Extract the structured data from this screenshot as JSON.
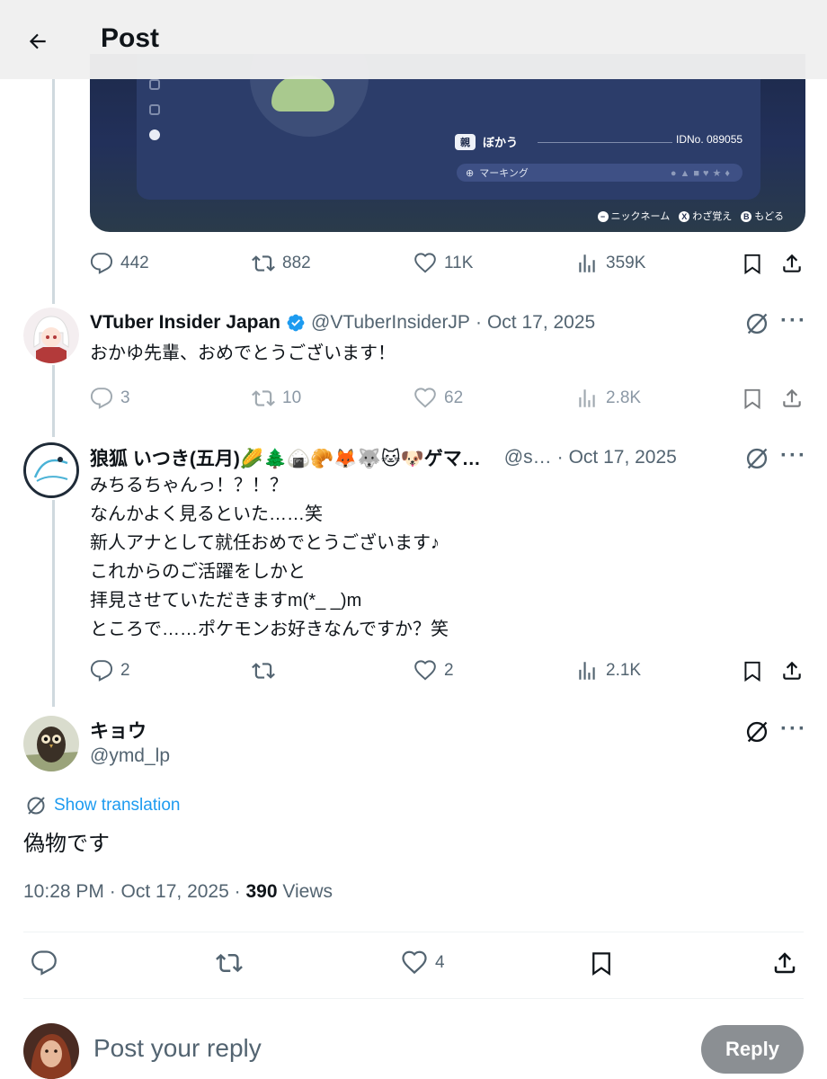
{
  "header": {
    "title": "Post"
  },
  "media": {
    "badge_label": "親",
    "trainer_name": "ぼかう",
    "id_no": "IDNo. 089055",
    "marking_label": "マーキング",
    "marking_shapes": "●▲■♥★♦",
    "footer": [
      {
        "key": "−",
        "label": "ニックネーム"
      },
      {
        "key": "X",
        "label": "わざ覚え"
      },
      {
        "key": "B",
        "label": "もどる"
      }
    ]
  },
  "quoted_post": {
    "stats": {
      "replies": "442",
      "reposts": "882",
      "likes": "11K",
      "views": "359K"
    }
  },
  "replies": [
    {
      "name": "VTuber Insider Japan",
      "handle": "@VTuberInsiderJP",
      "date": "Oct 17, 2025",
      "text": "おかゆ先輩、おめでとうございます！",
      "stats": {
        "replies": "3",
        "reposts": "10",
        "likes": "62",
        "views": "2.8K"
      }
    },
    {
      "name": "狼狐 いつき(五月)🌽🌲🍙🥐🦊🐺🐱🐶ゲマ…",
      "handle": "@s…",
      "date": "Oct 17, 2025",
      "text": "みちるちゃんっ！？！？\nなんかよく見るといた……笑\n新人アナとして就任おめでとうございます♪\nこれからのご活躍をしかと\n拝見させていただきますm(*_ _)m\nところで……ポケモンお好きなんですか？笑",
      "stats": {
        "replies": "2",
        "reposts": "",
        "likes": "2",
        "views": "2.1K"
      }
    }
  ],
  "main_post": {
    "name": "キョウ",
    "handle": "@ymd_lp",
    "translate_label": "Show translation",
    "text": "偽物です",
    "time": "10:28 PM · Oct 17, 2025 · ",
    "views_count": "390",
    "views_label": " Views",
    "stats": {
      "likes": "4"
    }
  },
  "reply_bar": {
    "placeholder": "Post your reply",
    "button": "Reply"
  },
  "colors": {
    "accent": "#1d9bf0",
    "verified": "#1d9bf0",
    "reply_button": "#8b8f93"
  }
}
